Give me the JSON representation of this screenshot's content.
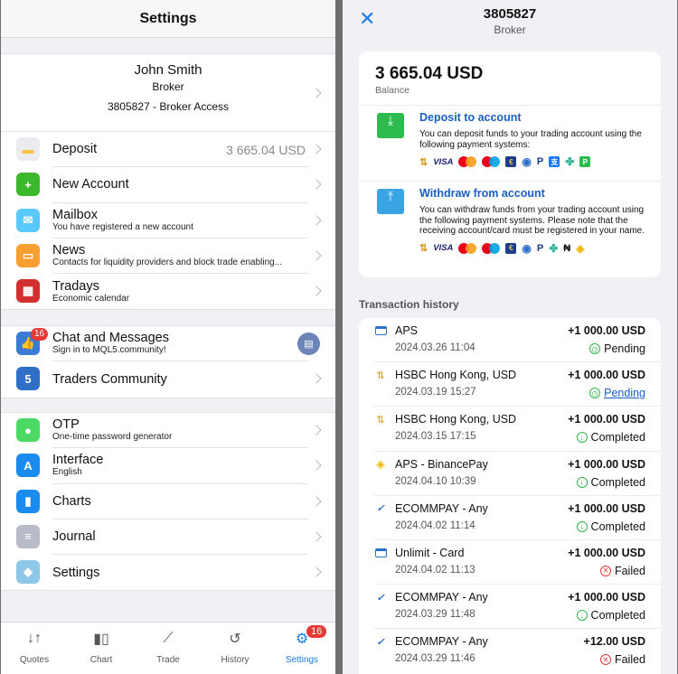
{
  "left": {
    "title": "Settings",
    "profile": {
      "name": "John Smith",
      "role": "Broker",
      "account": "3805827 - Broker Access"
    },
    "group1": [
      {
        "label": "Deposit",
        "value": "3 665.04 USD",
        "icon": "wallet-icon",
        "color": "#ececf0"
      },
      {
        "label": "New Account",
        "icon": "add-user-icon",
        "color": "#3cb82c"
      },
      {
        "label": "Mailbox",
        "sub": "You have registered a new account",
        "icon": "mail-icon",
        "color": "#5ac8fa"
      },
      {
        "label": "News",
        "sub": "Contacts for liquidity providers and block trade enabling...",
        "icon": "book-icon",
        "color": "#f7a031"
      },
      {
        "label": "Tradays",
        "sub": "Economic calendar",
        "icon": "calendar-icon",
        "color": "#d32f2f"
      }
    ],
    "group2": [
      {
        "label": "Chat and Messages",
        "sub": "Sign in to MQL5.community!",
        "icon": "thumbs-up-icon",
        "color": "#3a7bd5",
        "badge": "16"
      },
      {
        "label": "Traders Community",
        "icon": "mql5-icon",
        "color": "#2f6fc8"
      }
    ],
    "group3": [
      {
        "label": "OTP",
        "sub": "One-time password generator",
        "icon": "key-icon",
        "color": "#4cd964"
      },
      {
        "label": "Interface",
        "sub": "English",
        "icon": "language-icon",
        "color": "#1a8cf0"
      },
      {
        "label": "Charts",
        "icon": "candlestick-icon",
        "color": "#1a8cf0"
      },
      {
        "label": "Journal",
        "icon": "journal-icon",
        "color": "#b8bcc8"
      },
      {
        "label": "Settings",
        "icon": "metatrader-icon",
        "color": "#8ec7e8"
      }
    ],
    "tabs": [
      {
        "label": "Quotes",
        "glyph": "↓↑"
      },
      {
        "label": "Chart",
        "glyph": "▮▯"
      },
      {
        "label": "Trade",
        "glyph": "⟋"
      },
      {
        "label": "History",
        "glyph": "↺"
      },
      {
        "label": "Settings",
        "glyph": "⚙",
        "badge": "16",
        "active": true
      }
    ]
  },
  "right": {
    "header": {
      "title": "3805827",
      "subtitle": "Broker",
      "close_glyph": "✕"
    },
    "balance": {
      "amount": "3 665.04 USD",
      "label": "Balance"
    },
    "deposit": {
      "title": "Deposit to account",
      "desc": "You can deposit funds to your trading account using the following payment systems:",
      "methods": [
        "bank-transfer",
        "visa",
        "mastercard",
        "maestro",
        "euro-bank",
        "webmoney",
        "paypal",
        "alipay",
        "crypto-pay",
        "p-pay"
      ]
    },
    "withdraw": {
      "title": "Withdraw from account",
      "desc": "You can withdraw funds from your trading account using the following payment systems. Please note that the receiving account/card must be registered in your name.",
      "methods": [
        "bank-transfer",
        "visa",
        "mastercard",
        "maestro",
        "euro-bank",
        "webmoney",
        "paypal",
        "crypto-pay",
        "naira",
        "binance"
      ]
    },
    "history_label": "Transaction history",
    "transactions": [
      {
        "name": "APS",
        "date": "2024.03.26 11:04",
        "amount": "+1 000.00 USD",
        "status": "Pending",
        "icon": "card-icon",
        "kind": "pending"
      },
      {
        "name": "HSBC Hong Kong, USD",
        "date": "2024.03.19 15:27",
        "amount": "+1 000.00 USD",
        "status": "Pending",
        "icon": "bank-transfer-icon",
        "kind": "link"
      },
      {
        "name": "HSBC Hong Kong, USD",
        "date": "2024.03.15 17:15",
        "amount": "+1 000.00 USD",
        "status": "Completed",
        "icon": "bank-transfer-icon",
        "kind": "completed"
      },
      {
        "name": "APS - BinancePay",
        "date": "2024.04.10 10:39",
        "amount": "+1 000.00 USD",
        "status": "Completed",
        "icon": "binance-icon",
        "kind": "completed"
      },
      {
        "name": "ECOMMPAY - Any",
        "date": "2024.04.02 11:14",
        "amount": "+1 000.00 USD",
        "status": "Completed",
        "icon": "ecommpay-icon",
        "kind": "completed"
      },
      {
        "name": "Unlimit - Card",
        "date": "2024.04.02 11:13",
        "amount": "+1 000.00 USD",
        "status": "Failed",
        "icon": "card-icon",
        "kind": "failed"
      },
      {
        "name": "ECOMMPAY - Any",
        "date": "2024.03.29 11:48",
        "amount": "+1 000.00 USD",
        "status": "Completed",
        "icon": "ecommpay-icon",
        "kind": "completed"
      },
      {
        "name": "ECOMMPAY - Any",
        "date": "2024.03.29 11:46",
        "amount": "+12.00 USD",
        "status": "Failed",
        "icon": "ecommpay-icon",
        "kind": "failed"
      }
    ]
  }
}
